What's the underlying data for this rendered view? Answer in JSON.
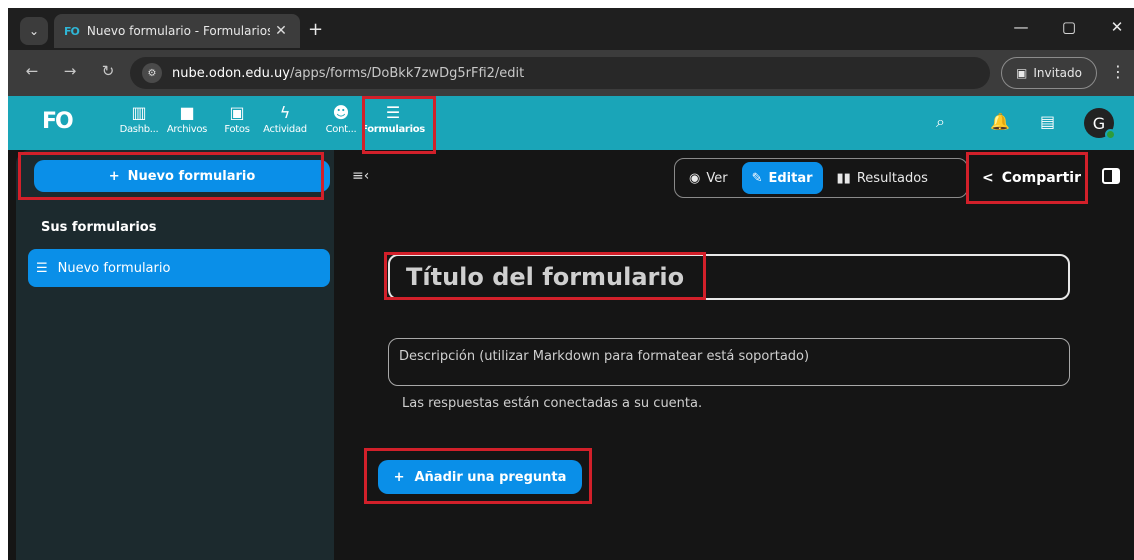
{
  "browser": {
    "tab_title": "Nuevo formulario - Formularios",
    "tab_favicon": "FO",
    "new_tab": "+",
    "url_host": "nube.odon.edu.uy",
    "url_path": "/apps/forms/DoBkk7zwDg5rFfi2/edit",
    "guest_label": "Invitado",
    "controls": {
      "minimize": "—",
      "maximize": "▢",
      "close": "✕"
    }
  },
  "app": {
    "logo": "FO",
    "nav": [
      {
        "label": "Dashb...",
        "icon": "dashboard-icon",
        "active": false
      },
      {
        "label": "Archivos",
        "icon": "folder-icon",
        "active": false
      },
      {
        "label": "Fotos",
        "icon": "image-icon",
        "active": false
      },
      {
        "label": "Actividad",
        "icon": "bolt-icon",
        "active": false
      },
      {
        "label": "Cont...",
        "icon": "contacts-icon",
        "active": false
      },
      {
        "label": "Formularios",
        "icon": "list-icon",
        "active": true
      }
    ],
    "avatar_letter": "G",
    "accent_color": "#1aa5b8"
  },
  "sidebar": {
    "new_form_label": "Nuevo formulario",
    "section_title": "Sus formularios",
    "forms": [
      {
        "label": "Nuevo formulario"
      }
    ]
  },
  "toolbar": {
    "view_label": "Ver",
    "edit_label": "Editar",
    "results_label": "Resultados",
    "share_label": "Compartir"
  },
  "editor": {
    "title_placeholder": "Título del formulario",
    "description_placeholder": "Descripción (utilizar Markdown para formatear está soportado)",
    "note": "Las respuestas están conectadas a su cuenta.",
    "add_question_label": "Añadir una pregunta"
  }
}
